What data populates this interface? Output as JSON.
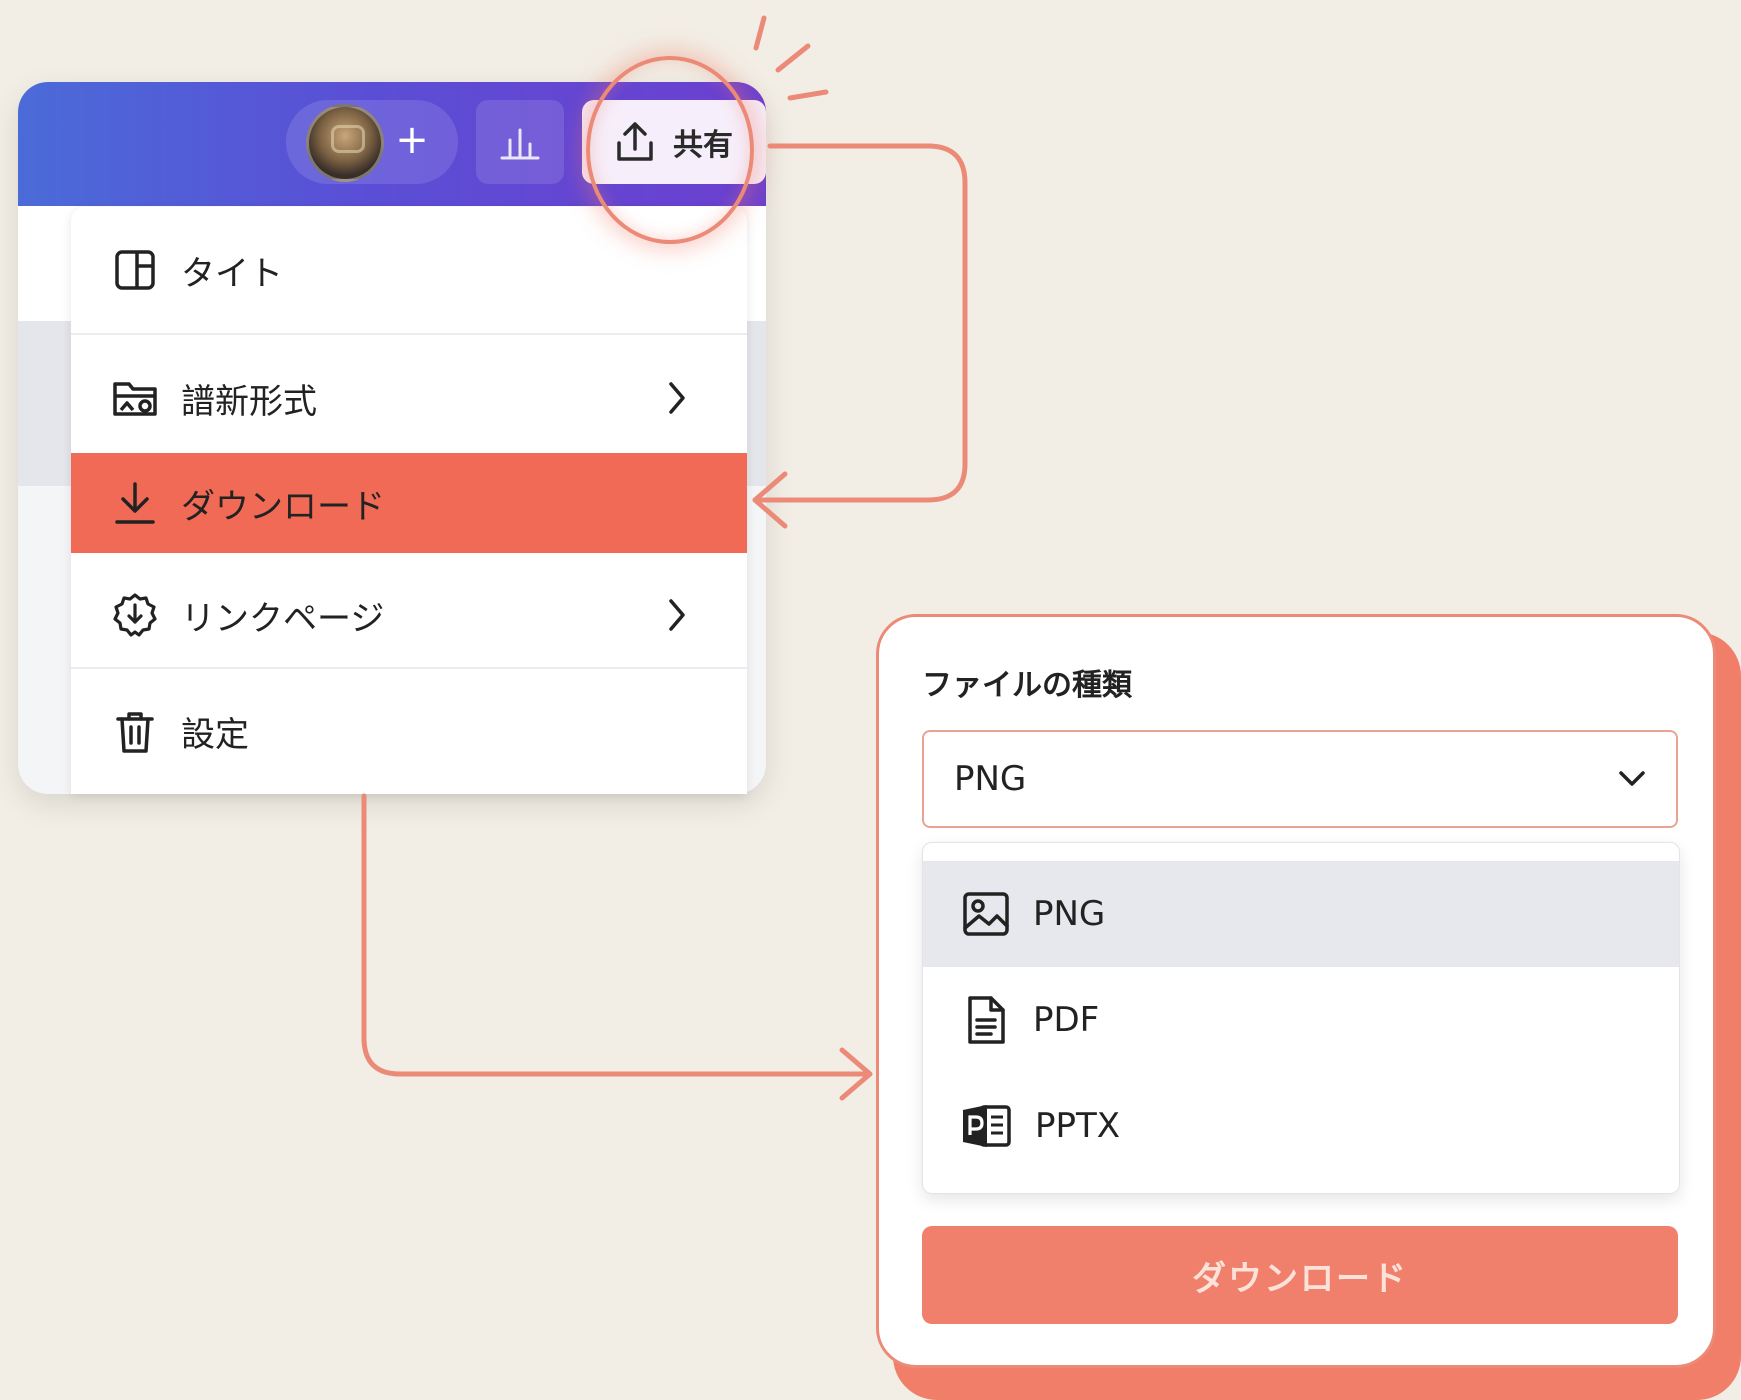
{
  "topbar": {
    "add_collaborator": "+",
    "share_label": "共有"
  },
  "menu": {
    "items": [
      {
        "label": "タイト",
        "icon": "layout-panel-icon",
        "has_submenu": false
      },
      {
        "label": "譜新形式",
        "icon": "folder-image-icon",
        "has_submenu": true
      },
      {
        "label": "ダウンロード",
        "icon": "download-icon",
        "has_submenu": false,
        "highlighted": true
      },
      {
        "label": "リンクページ",
        "icon": "link-badge-icon",
        "has_submenu": true
      },
      {
        "label": "設定",
        "icon": "trash-icon",
        "has_submenu": false
      }
    ]
  },
  "download_panel": {
    "title": "ファイルの種類",
    "selected": "PNG",
    "options": [
      {
        "label": "PNG",
        "icon": "image-icon",
        "selected": true
      },
      {
        "label": "PDF",
        "icon": "document-icon",
        "selected": false
      },
      {
        "label": "PPTX",
        "icon": "powerpoint-icon",
        "selected": false
      }
    ],
    "button_label": "ダウンロード"
  },
  "colors": {
    "accent": "#f06a55",
    "connector": "#ec8a78",
    "topbar_start": "#4b6bd8",
    "topbar_end": "#6c3fcf",
    "background": "#f2eee5"
  }
}
